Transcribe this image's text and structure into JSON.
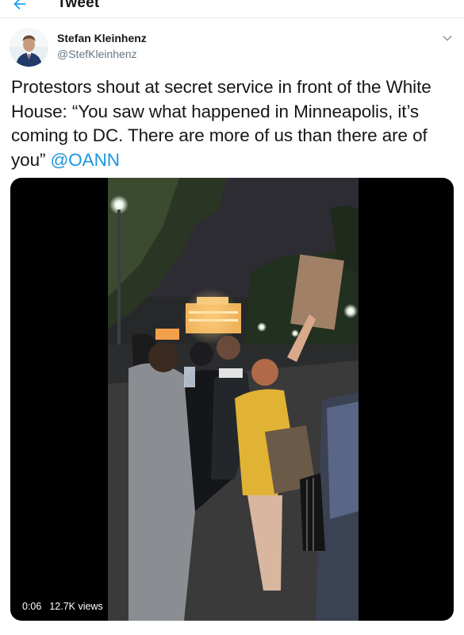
{
  "header": {
    "title": "Tweet",
    "back_icon": "back-arrow-icon"
  },
  "author": {
    "name": "Stefan Kleinhenz",
    "handle": "@StefKleinhenz"
  },
  "tweet": {
    "text": "Protestors shout at secret service in front of the White House: “You saw what happened in Minneapolis, it’s coming to DC. There are more of us than there are of you”",
    "mention": "@OANN"
  },
  "video": {
    "time": "0:06",
    "views": "12.7K views"
  },
  "colors": {
    "link": "#1b95e0",
    "accent": "#1da1f2",
    "text": "#14171a",
    "secondary": "#657786"
  }
}
